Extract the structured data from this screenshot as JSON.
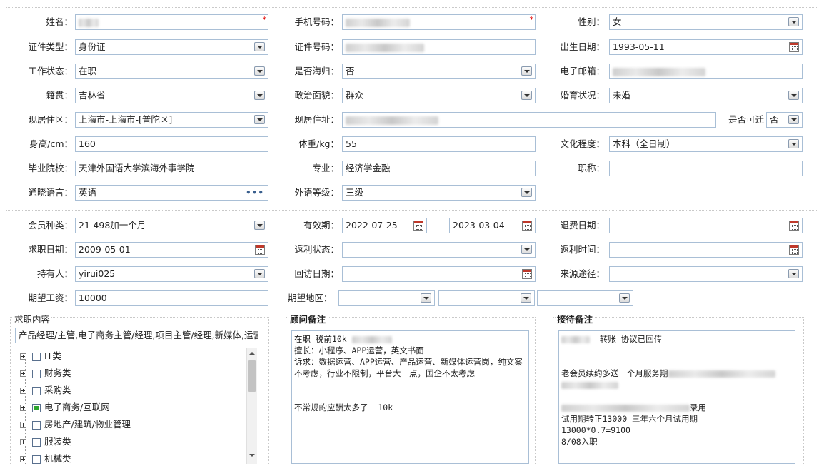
{
  "personal": {
    "name_label": "姓名：",
    "phone_label": "手机号码：",
    "gender_label": "性别：",
    "gender_value": "女",
    "id_type_label": "证件类型：",
    "id_type_value": "身份证",
    "id_no_label": "证件号码：",
    "birth_label": "出生日期：",
    "birth_value": "1993-05-11",
    "work_status_label": "工作状态：",
    "work_status_value": "在职",
    "overseas_label": "是否海归：",
    "overseas_value": "否",
    "email_label": "电子邮箱：",
    "native_label": "籍贯：",
    "native_value": "吉林省",
    "political_label": "政治面貌：",
    "political_value": "群众",
    "marital_label": "婚育状况：",
    "marital_value": "未婚",
    "residence_area_label": "现居住区：",
    "residence_area_value": "上海市-上海市-[普陀区]",
    "address_label": "现居住址：",
    "relocate_label": "是否可迁",
    "relocate_value": "否",
    "height_label": "身高/cm：",
    "height_value": "160",
    "weight_label": "体重/kg：",
    "weight_value": "55",
    "education_label": "文化程度：",
    "education_value": "本科（全日制）",
    "school_label": "毕业院校：",
    "school_value": "天津外国语大学滨海外事学院",
    "major_label": "专业：",
    "major_value": "经济学金融",
    "title_label": "职称：",
    "title_value": "",
    "language_label": "通晓语言：",
    "language_value": "英语",
    "language_more": "•••",
    "foreign_level_label": "外语等级：",
    "foreign_level_value": "三级"
  },
  "membership": {
    "type_label": "会员种类：",
    "type_value": "21-498加一个月",
    "valid_label": "有效期：",
    "valid_from": "2022-07-25",
    "valid_sep": "----",
    "valid_to": "2023-03-04",
    "refund_date_label": "退费日期：",
    "job_date_label": "求职日期：",
    "job_date_value": "2009-05-01",
    "rebate_status_label": "返利状态：",
    "rebate_time_label": "返利时间：",
    "holder_label": "持有人：",
    "holder_value": "yirui025",
    "visit_date_label": "回访日期：",
    "source_label": "来源途径：",
    "salary_label": "期望工资：",
    "salary_value": "10000",
    "region_label": "期望地区："
  },
  "job_content": {
    "title": "求职内容",
    "summary": "产品经理/主管,电子商务主管/经理,项目主管/经理,新媒体,运营",
    "tree": [
      {
        "label": "IT类",
        "checked": false
      },
      {
        "label": "财务类",
        "checked": false
      },
      {
        "label": "采购类",
        "checked": false
      },
      {
        "label": "电子商务/互联网",
        "checked": true
      },
      {
        "label": "房地产/建筑/物业管理",
        "checked": false
      },
      {
        "label": "服装类",
        "checked": false
      },
      {
        "label": "机械类",
        "checked": false
      }
    ]
  },
  "advisor_notes": {
    "title": "顾问备注",
    "line1": "在职 税前10k ",
    "body": "擅长：小程序、APP运营，英文书面\n诉求：数据运营、APP运营、产品运营、新媒体运营岗，纯文案不考虑，行业不限制，平台大一点，国企不太考虑\n\n\n不常规的应酬太多了  10k"
  },
  "reception_notes": {
    "title": "接待备注",
    "line1": "  转账 协议已回传",
    "line2": "老会员续约多送一个月服务期",
    "line3_suffix": "录用",
    "body": "试用期转正13000 三年六个月试用期\n13000*0.7=9100\n8/08入职"
  }
}
